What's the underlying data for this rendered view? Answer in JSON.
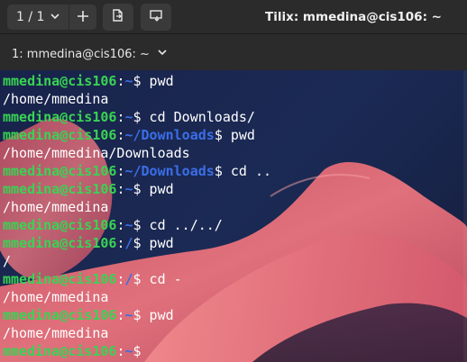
{
  "titlebar": {
    "session_label": "1 / 1",
    "window_title": "Tilix: mmedina@cis106: ~"
  },
  "tab": {
    "label": "1: mmedina@cis106: ~"
  },
  "icons": {
    "session_chevron": "chevron-down-icon",
    "add": "plus-icon",
    "split_right": "split-right-icon",
    "split_down": "split-down-icon",
    "tab_chevron": "chevron-down-icon"
  },
  "colors": {
    "user_host": "#39d353",
    "directory": "#3b6ee8",
    "text": "#ffffff",
    "chrome": "#2b2b2b"
  },
  "terminal": {
    "lines": [
      {
        "type": "prompt",
        "user": "mmedina@cis106",
        "sep": ":",
        "dir": "~",
        "sym": "$",
        "cmd": " pwd"
      },
      {
        "type": "output",
        "text": "/home/mmedina"
      },
      {
        "type": "prompt",
        "user": "mmedina@cis106",
        "sep": ":",
        "dir": "~",
        "sym": "$",
        "cmd": " cd Downloads/"
      },
      {
        "type": "prompt",
        "user": "mmedina@cis106",
        "sep": ":",
        "dir": "~/Downloads",
        "sym": "$",
        "cmd": " pwd"
      },
      {
        "type": "output",
        "text": "/home/mmedina/Downloads"
      },
      {
        "type": "prompt",
        "user": "mmedina@cis106",
        "sep": ":",
        "dir": "~/Downloads",
        "sym": "$",
        "cmd": " cd .."
      },
      {
        "type": "prompt",
        "user": "mmedina@cis106",
        "sep": ":",
        "dir": "~",
        "sym": "$",
        "cmd": " pwd"
      },
      {
        "type": "output",
        "text": "/home/mmedina"
      },
      {
        "type": "prompt",
        "user": "mmedina@cis106",
        "sep": ":",
        "dir": "~",
        "sym": "$",
        "cmd": " cd ../../"
      },
      {
        "type": "prompt",
        "user": "mmedina@cis106",
        "sep": ":",
        "dir": "/",
        "sym": "$",
        "cmd": " pwd"
      },
      {
        "type": "output",
        "text": "/"
      },
      {
        "type": "prompt",
        "user": "mmedina@cis106",
        "sep": ":",
        "dir": "/",
        "sym": "$",
        "cmd": " cd -"
      },
      {
        "type": "output",
        "text": "/home/mmedina"
      },
      {
        "type": "prompt",
        "user": "mmedina@cis106",
        "sep": ":",
        "dir": "~",
        "sym": "$",
        "cmd": " pwd"
      },
      {
        "type": "output",
        "text": "/home/mmedina"
      },
      {
        "type": "prompt",
        "user": "mmedina@cis106",
        "sep": ":",
        "dir": "~",
        "sym": "$",
        "cmd": " "
      }
    ]
  }
}
